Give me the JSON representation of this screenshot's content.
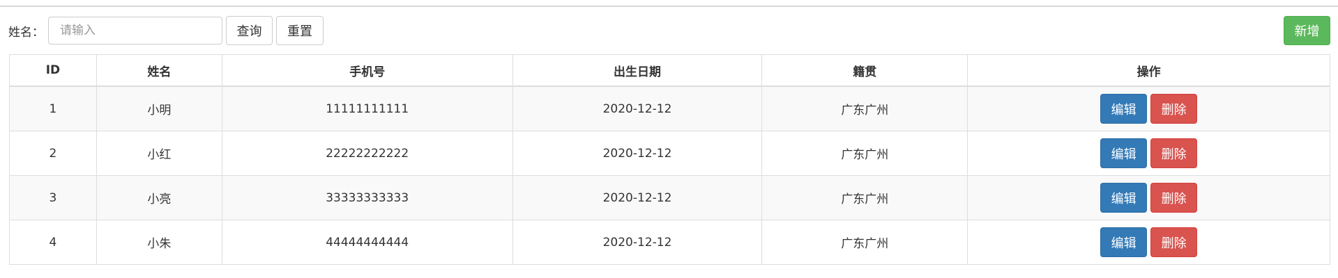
{
  "search": {
    "label": "姓名：",
    "placeholder": "请输入",
    "value": "",
    "query_label": "查询",
    "reset_label": "重置"
  },
  "toolbar": {
    "add_label": "新增"
  },
  "table": {
    "headers": {
      "id": "ID",
      "name": "姓名",
      "phone": "手机号",
      "birth": "出生日期",
      "origin": "籍贯",
      "ops": "操作"
    },
    "rows": [
      {
        "id": "1",
        "name": "小明",
        "phone": "11111111111",
        "birth": "2020-12-12",
        "origin": "广东广州"
      },
      {
        "id": "2",
        "name": "小红",
        "phone": "22222222222",
        "birth": "2020-12-12",
        "origin": "广东广州"
      },
      {
        "id": "3",
        "name": "小亮",
        "phone": "33333333333",
        "birth": "2020-12-12",
        "origin": "广东广州"
      },
      {
        "id": "4",
        "name": "小朱",
        "phone": "44444444444",
        "birth": "2020-12-12",
        "origin": "广东广州"
      }
    ],
    "edit_label": "编辑",
    "delete_label": "删除"
  },
  "colors": {
    "add": "#5cb85c",
    "edit": "#337ab7",
    "delete": "#d9534f",
    "border": "#dddddd",
    "stripe": "#f9f9f9"
  }
}
